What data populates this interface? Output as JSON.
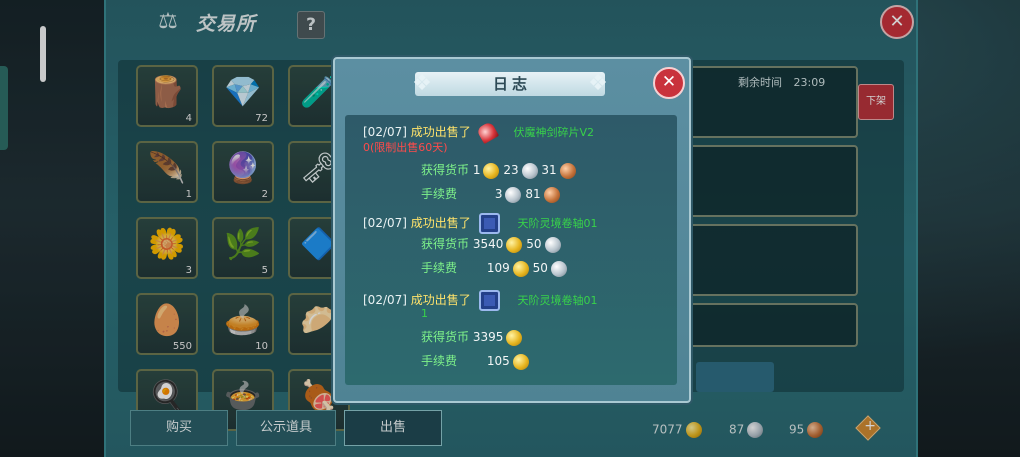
{
  "window": {
    "title": "交易所",
    "help_label": "?",
    "close_label": "✕"
  },
  "grid_items": [
    {
      "icon": "log-icon",
      "glyph": "🪵",
      "qty": "4"
    },
    {
      "icon": "red-gem-icon",
      "glyph": "💎",
      "qty": "72"
    },
    {
      "icon": "potion-icon",
      "glyph": "🧪",
      "qty": ""
    },
    {
      "icon": "feather-icon",
      "glyph": "🪶",
      "qty": "1"
    },
    {
      "icon": "blue-orb-icon",
      "glyph": "🔮",
      "qty": "2"
    },
    {
      "icon": "key-icon",
      "glyph": "🗝",
      "qty": ""
    },
    {
      "icon": "blue-flower-icon",
      "glyph": "🌼",
      "qty": "3"
    },
    {
      "icon": "herb-icon",
      "glyph": "🌿",
      "qty": "5"
    },
    {
      "icon": "rune-icon",
      "glyph": "🔷",
      "qty": ""
    },
    {
      "icon": "egg-icon",
      "glyph": "🥚",
      "qty": "550"
    },
    {
      "icon": "pie-icon",
      "glyph": "🥧",
      "qty": "10"
    },
    {
      "icon": "dumpling-icon",
      "glyph": "🥟",
      "qty": "10"
    },
    {
      "icon": "food-icon",
      "glyph": "🍳",
      "qty": ""
    },
    {
      "icon": "dish-icon",
      "glyph": "🍲",
      "qty": ""
    },
    {
      "icon": "meat-icon",
      "glyph": "🍖",
      "qty": ""
    }
  ],
  "listing": {
    "time_label": "剩余时间",
    "time_value": "23:09",
    "unlist_label": "下架"
  },
  "tabs": {
    "buy": "购买",
    "public": "公示道具",
    "sell": "出售"
  },
  "currency": {
    "gold": "7077",
    "silver": "87",
    "copper": "95",
    "plus": "+"
  },
  "dialog": {
    "title": "日志",
    "close_label": "✕",
    "entries": [
      {
        "date": "[02/07]",
        "sold": "成功出售了",
        "item_line1": "伏魔神剑碎片V2",
        "item_line2": "0(限制出售60天)",
        "earn_label": "获得货币",
        "earn": {
          "gold": "1",
          "silver": "23",
          "copper": "31"
        },
        "fee_label": "手续费",
        "fee": {
          "silver": "3",
          "copper": "81"
        }
      },
      {
        "date": "[02/07]",
        "sold": "成功出售了",
        "item_line1": "天阶灵境卷轴01",
        "earn_label": "获得货币",
        "earn": {
          "gold": "3540",
          "silver": "50"
        },
        "fee_label": "手续费",
        "fee": {
          "gold": "109",
          "silver": "50"
        }
      },
      {
        "date": "[02/07]",
        "sold": "成功出售了",
        "item_line1": "天阶灵境卷轴01",
        "item_line2": "1",
        "earn_label": "获得货币",
        "earn": {
          "gold": "3395"
        },
        "fee_label": "手续费",
        "fee": {
          "gold": "105"
        }
      }
    ]
  }
}
